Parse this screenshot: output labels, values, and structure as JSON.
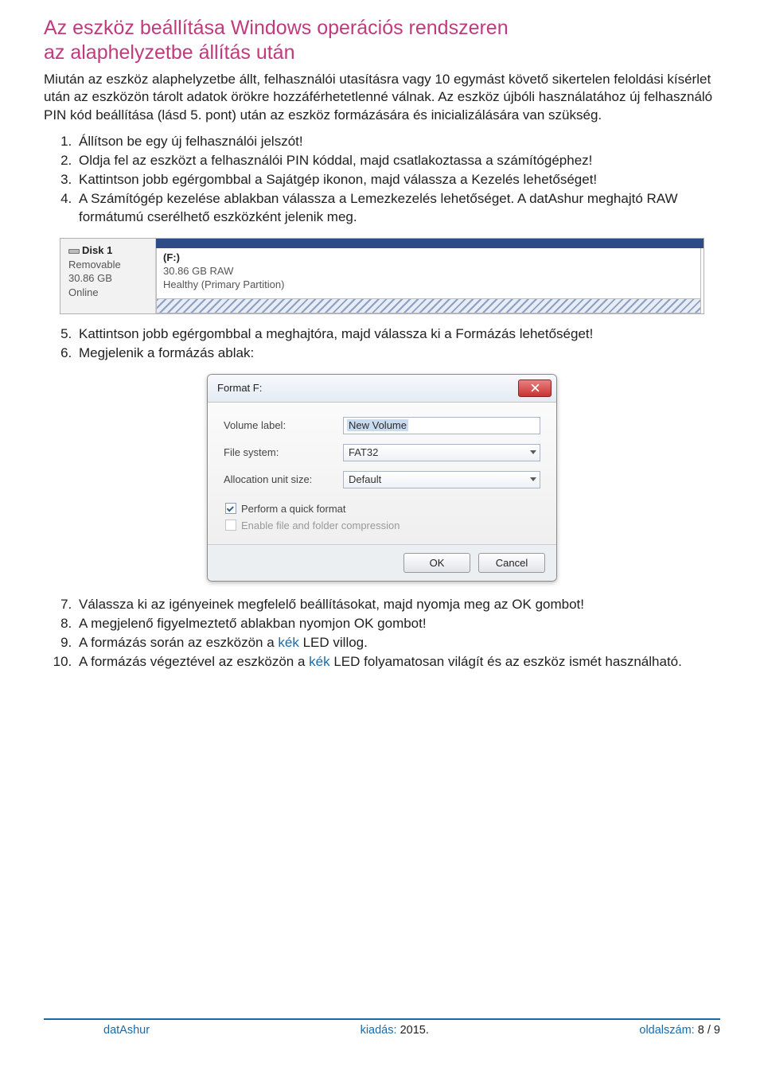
{
  "heading_l1": "Az eszköz beállítása Windows operációs rendszeren",
  "heading_l2": "az alaphelyzetbe állítás után",
  "intro": "Miután az eszköz alaphelyzetbe állt, felhasználói utasításra vagy 10 egymást követő sikertelen feloldási kísérlet után az eszközön tárolt adatok örökre hozzáférhetetlenné válnak. Az eszköz újbóli használatához új felhasználó PIN kód beállítása (lásd 5. pont) után az eszköz formázására és inicializálására van szükség.",
  "steps1": [
    "Állítson be egy új felhasználói jelszót!",
    "Oldja fel az eszközt a felhasználói PIN kóddal, majd csatlakoztassa a számítógéphez!",
    "Kattintson jobb egérgombbal a Sajátgép ikonon, majd válassza a Kezelés lehetőséget!",
    "A Számítógép kezelése ablakban válassza a Lemezkezelés lehetőséget. A datAshur meghajtó RAW formátumú cserélhető eszközként jelenik meg."
  ],
  "disk": {
    "name": "Disk 1",
    "type": "Removable",
    "size": "30.86 GB",
    "status": "Online",
    "drive_letter": "(F:)",
    "partition_size": "30.86 GB RAW",
    "partition_health": "Healthy (Primary Partition)"
  },
  "steps2": [
    "Kattintson jobb egérgombbal a meghajtóra, majd válassza ki a Formázás lehetőséget!",
    "Megjelenik a formázás ablak:"
  ],
  "dialog": {
    "title": "Format F:",
    "volume_label_label": "Volume label:",
    "volume_label_value": "New Volume",
    "filesystem_label": "File system:",
    "filesystem_value": "FAT32",
    "alloc_label": "Allocation unit size:",
    "alloc_value": "Default",
    "quick_format_label": "Perform a quick format",
    "compression_label": "Enable file and folder compression",
    "ok": "OK",
    "cancel": "Cancel"
  },
  "steps3_7": "Válassza ki az igényeinek megfelelő beállításokat, majd nyomja meg az OK gombot!",
  "steps3_8": "A megjelenő figyelmeztető ablakban nyomjon OK gombot!",
  "steps3_9_pre": "A formázás során az eszközön a ",
  "steps3_9_blue": "kék",
  "steps3_9_post": " LED villog.",
  "steps3_10_pre": "A formázás végeztével az eszközön a ",
  "steps3_10_blue": "kék",
  "steps3_10_post": " LED folyamatosan világít és az eszköz ismét használható.",
  "footer": {
    "product": "datAshur",
    "issue_label": "kiadás:",
    "issue_value": "2015.",
    "page_label": "oldalszám:",
    "page_current": "8",
    "page_sep": "/",
    "page_total": "9"
  }
}
